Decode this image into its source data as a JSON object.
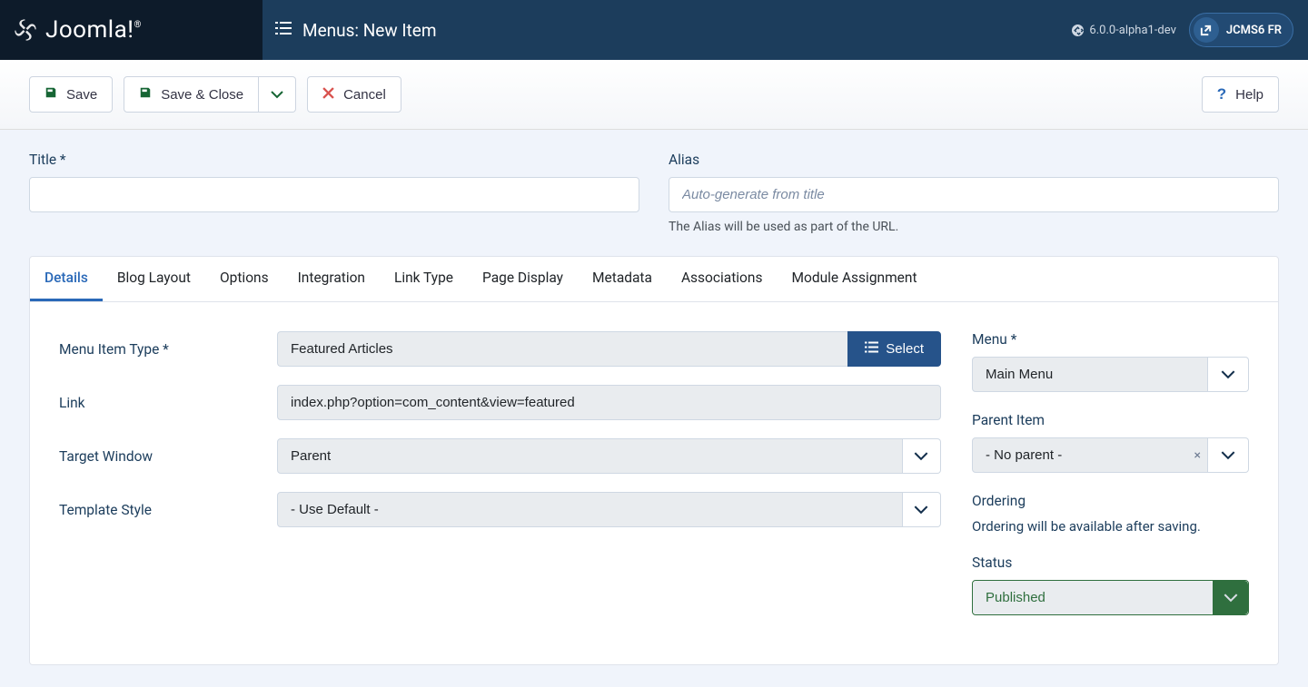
{
  "brand": "Joomla!",
  "page_title": "Menus: New Item",
  "version": "6.0.0-alpha1-dev",
  "profile_label": "JCMS6 FR",
  "toolbar": {
    "save": "Save",
    "save_close": "Save & Close",
    "cancel": "Cancel",
    "help": "Help"
  },
  "top": {
    "title_label": "Title *",
    "alias_label": "Alias",
    "alias_placeholder": "Auto-generate from title",
    "alias_hint": "The Alias will be used as part of the URL."
  },
  "tabs": [
    "Details",
    "Blog Layout",
    "Options",
    "Integration",
    "Link Type",
    "Page Display",
    "Metadata",
    "Associations",
    "Module Assignment"
  ],
  "details": {
    "menu_item_type_label": "Menu Item Type *",
    "menu_item_type_value": "Featured Articles",
    "select_btn": "Select",
    "link_label": "Link",
    "link_value": "index.php?option=com_content&view=featured",
    "target_window_label": "Target Window",
    "target_window_value": "Parent",
    "template_style_label": "Template Style",
    "template_style_value": "- Use Default -"
  },
  "side": {
    "menu_label": "Menu *",
    "menu_value": "Main Menu",
    "parent_label": "Parent Item",
    "parent_value": "- No parent -",
    "ordering_label": "Ordering",
    "ordering_text": "Ordering will be available after saving.",
    "status_label": "Status",
    "status_value": "Published"
  }
}
